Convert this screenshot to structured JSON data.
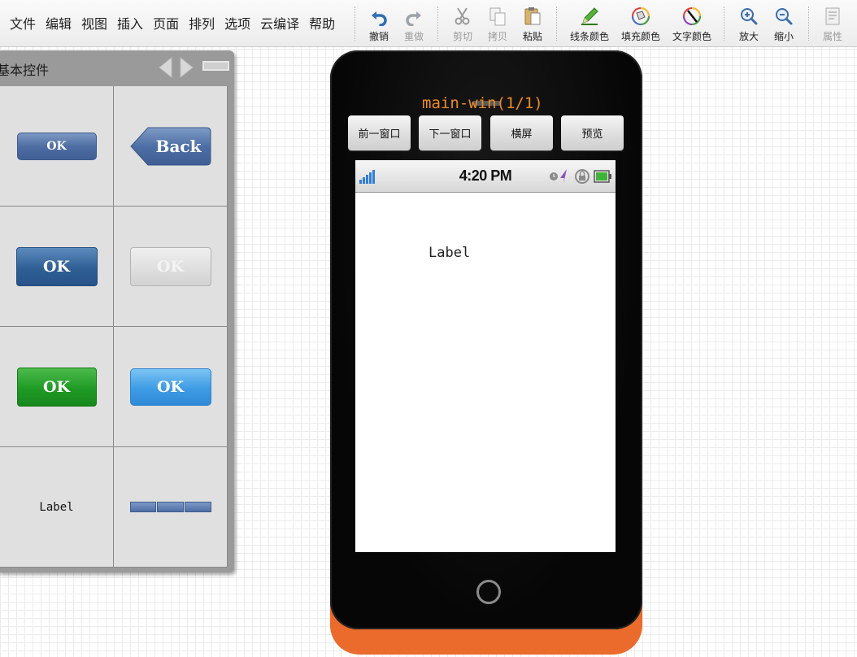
{
  "menu": [
    "文件",
    "编辑",
    "视图",
    "插入",
    "页面",
    "排列",
    "选项",
    "云编译",
    "帮助"
  ],
  "toolbar": {
    "undo": "撤销",
    "redo": "重做",
    "cut": "剪切",
    "copy": "拷贝",
    "paste": "粘贴",
    "line_color": "线条颜色",
    "fill_color": "填充颜色",
    "text_color": "文字颜色",
    "zoom_in": "放大",
    "zoom_out": "缩小",
    "properties": "属性",
    "disabled": [
      "redo",
      "cut",
      "copy",
      "properties"
    ]
  },
  "panel": {
    "title": "基本控件",
    "widgets": {
      "ok_small": "OK",
      "back": "Back",
      "ok_dark": "OK",
      "ok_disabled": "OK",
      "ok_green": "OK",
      "ok_lightblue": "OK",
      "label": "Label",
      "segmented_count": 3
    }
  },
  "phone": {
    "window_title": "main-win(1/1)",
    "buttons": {
      "prev": "前一窗口",
      "next": "下一窗口",
      "landscape": "横屏",
      "preview": "预览"
    },
    "status_time": "4:20 PM",
    "screen_label": "Label"
  },
  "colors": {
    "phone_accent": "#ea6b2c",
    "window_title": "#f08a20",
    "icon_blue": "#2f6fb5"
  }
}
